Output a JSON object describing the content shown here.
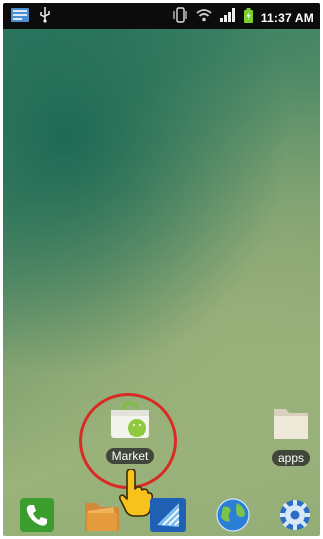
{
  "status_bar": {
    "time": "11:37 AM",
    "icons": [
      "notification-icon",
      "usb-icon",
      "vibrate-icon",
      "wifi-icon",
      "signal-icon",
      "battery-icon"
    ]
  },
  "home": {
    "apps": [
      {
        "label": "Market",
        "icon": "market-bag-icon"
      },
      {
        "label": "apps",
        "icon": "folder-icon"
      }
    ]
  },
  "dock": {
    "items": [
      "phone-icon",
      "gallery-folder-icon",
      "launcher-icon",
      "browser-globe-icon",
      "settings-gear-icon"
    ]
  },
  "colors": {
    "highlight": "#d92b26",
    "status_bar": "#0c0c0c",
    "wifi": "#3ea3e8",
    "battery": "#7ad12e"
  }
}
